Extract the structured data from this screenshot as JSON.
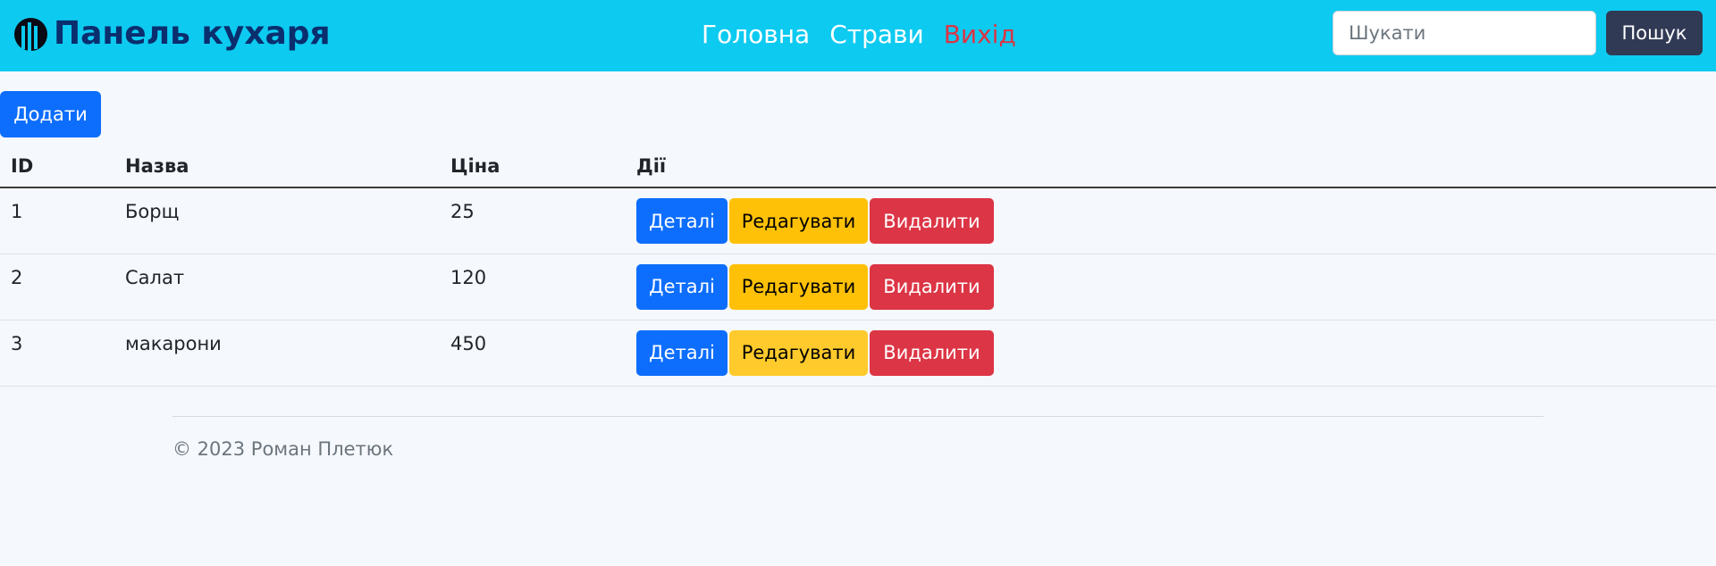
{
  "header": {
    "brand_title": "Панель кухаря",
    "nav": [
      {
        "label": "Головна"
      },
      {
        "label": "Страви"
      },
      {
        "label": "Вихід"
      }
    ],
    "search": {
      "placeholder": "Шукати",
      "value": "",
      "button_label": "Пошук"
    }
  },
  "main": {
    "add_button_label": "Додати",
    "table": {
      "columns": [
        "ID",
        "Назва",
        "Ціна",
        "Дії"
      ],
      "rows": [
        {
          "id": "1",
          "name": "Борщ",
          "price": "25"
        },
        {
          "id": "2",
          "name": "Салат",
          "price": "120"
        },
        {
          "id": "3",
          "name": "макарони",
          "price": "450"
        }
      ],
      "actions": {
        "details_label": "Деталі",
        "edit_label": "Редагувати",
        "delete_label": "Видалити"
      }
    }
  },
  "footer": {
    "text": "© 2023 Роман Плетюк"
  },
  "colors": {
    "navbar": "#0dcaf0",
    "brand_text": "#0a2e6e",
    "primary": "#0d6efd",
    "warning": "#ffc107",
    "danger": "#dc3545",
    "search_button": "#303a55",
    "page_background": "#f5f8fd"
  },
  "icons": {
    "brand": "bar-columns-icon"
  }
}
